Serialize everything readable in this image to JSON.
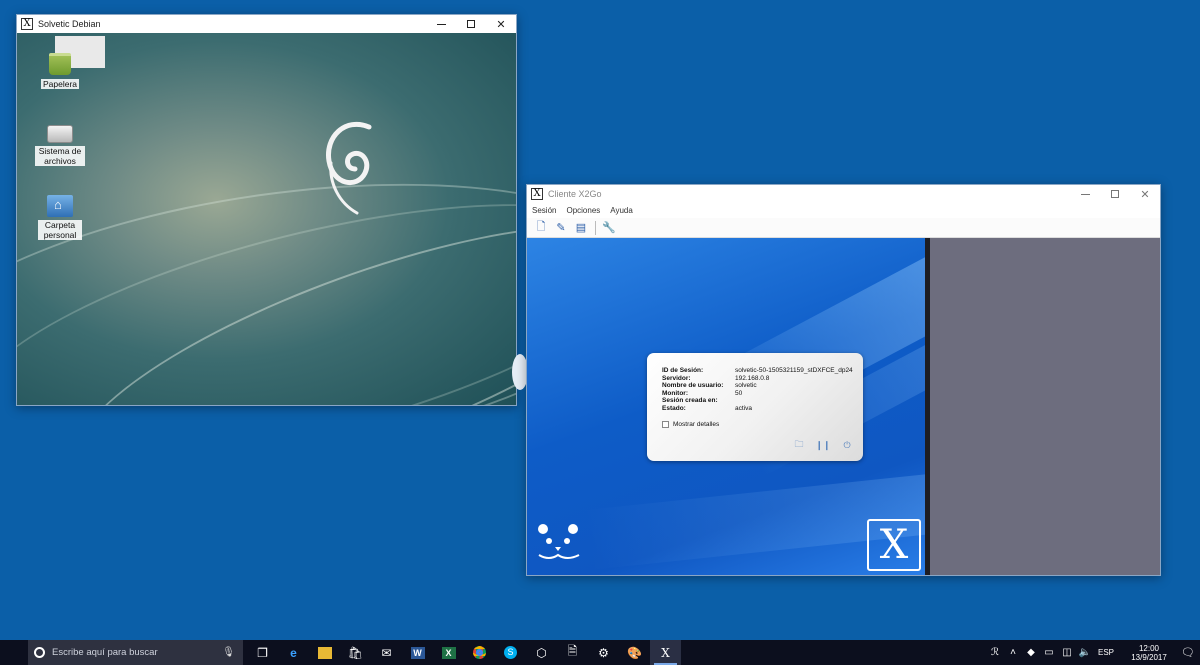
{
  "debian_window": {
    "title": "Solvetic Debian",
    "icons": [
      {
        "label": "Papelera"
      },
      {
        "label": "Sistema de archivos"
      },
      {
        "label": "Carpeta personal"
      }
    ]
  },
  "x2go_window": {
    "title": "Cliente X2Go",
    "menu": [
      "Sesión",
      "Opciones",
      "Ayuda"
    ],
    "session": {
      "rows": [
        {
          "key": "ID de Sesión:",
          "value": "solvetic-50-1505321159_stDXFCE_dp24"
        },
        {
          "key": "Servidor:",
          "value": "192.168.0.8"
        },
        {
          "key": "Nombre de usuario:",
          "value": "solvetic"
        },
        {
          "key": "Monitor:",
          "value": "50"
        },
        {
          "key": "Sesión creada en:",
          "value": ""
        },
        {
          "key": "Estado:",
          "value": "activa"
        }
      ],
      "details_label": "Mostrar detalles"
    }
  },
  "taskbar": {
    "search_placeholder": "Escribe aquí para buscar",
    "language": "ESP",
    "time": "12:00",
    "date": "13/9/2017"
  },
  "colors": {
    "desktop": "#0b5fa8",
    "taskbar": "#0c0f1e",
    "x2go_blue": "#0e5cc7",
    "x2go_gray": "#6d6d7e"
  }
}
